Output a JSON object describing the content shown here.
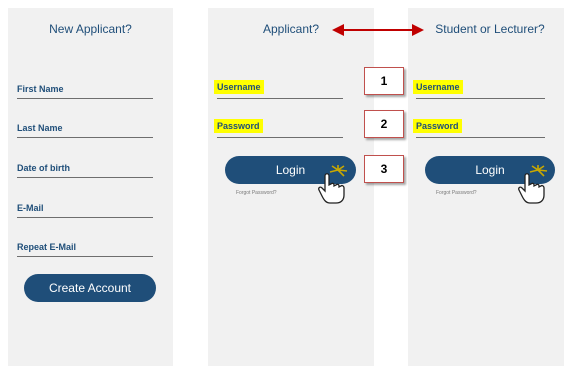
{
  "register_panel": {
    "title": "New Applicant?",
    "fields": [
      "First Name",
      "Last Name",
      "Date of birth",
      "E-Mail",
      "Repeat E-Mail"
    ],
    "button": "Create Account"
  },
  "applicant_panel": {
    "title": "Applicant?",
    "username_label": "Username",
    "password_label": "Password",
    "button": "Login",
    "forgot": "Forgot Password?"
  },
  "student_panel": {
    "title": "Student or Lecturer?",
    "username_label": "Username",
    "password_label": "Password",
    "button": "Login",
    "forgot": "Forgot Password?"
  },
  "steps": [
    "1",
    "2",
    "3"
  ],
  "colors": {
    "accent": "#1f4e79",
    "highlight": "#ffff00",
    "marker": "#c0504d",
    "arrow": "#c00000"
  }
}
